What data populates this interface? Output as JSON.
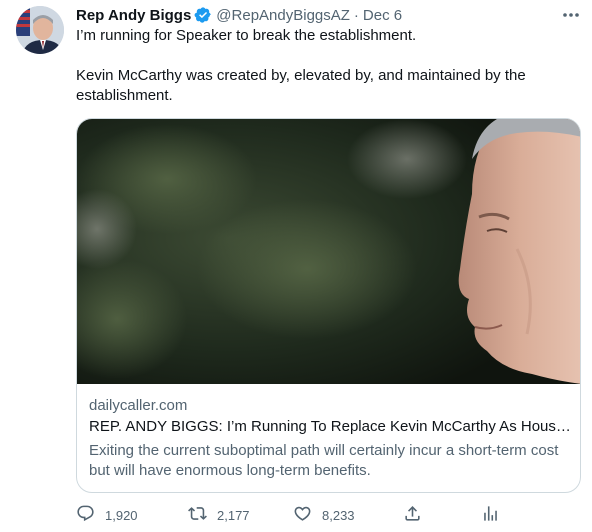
{
  "tweet": {
    "author_name": "Rep Andy Biggs",
    "handle": "@RepAndyBiggsAZ",
    "separator": "·",
    "date": "Dec 6",
    "text_line1": "I’m running for Speaker to break the establishment.",
    "text_line2": "Kevin McCarthy was created by, elevated by, and maintained by the establishment."
  },
  "card": {
    "domain": "dailycaller.com",
    "title": "REP. ANDY BIGGS: I’m Running To Replace Kevin McCarthy As House...",
    "description": "Exiting the current suboptimal path will certainly incur a short-term cost but will have enormous long-term benefits."
  },
  "actions": {
    "replies": "1,920",
    "retweets": "2,177",
    "likes": "8,233"
  },
  "colors": {
    "text_primary": "#0f1419",
    "text_secondary": "#536471",
    "verified_blue": "#1d9bf0",
    "border": "#cfd9de"
  },
  "icons": [
    "more-icon",
    "verified-icon",
    "reply-icon",
    "retweet-icon",
    "like-icon",
    "share-icon",
    "analytics-icon"
  ]
}
